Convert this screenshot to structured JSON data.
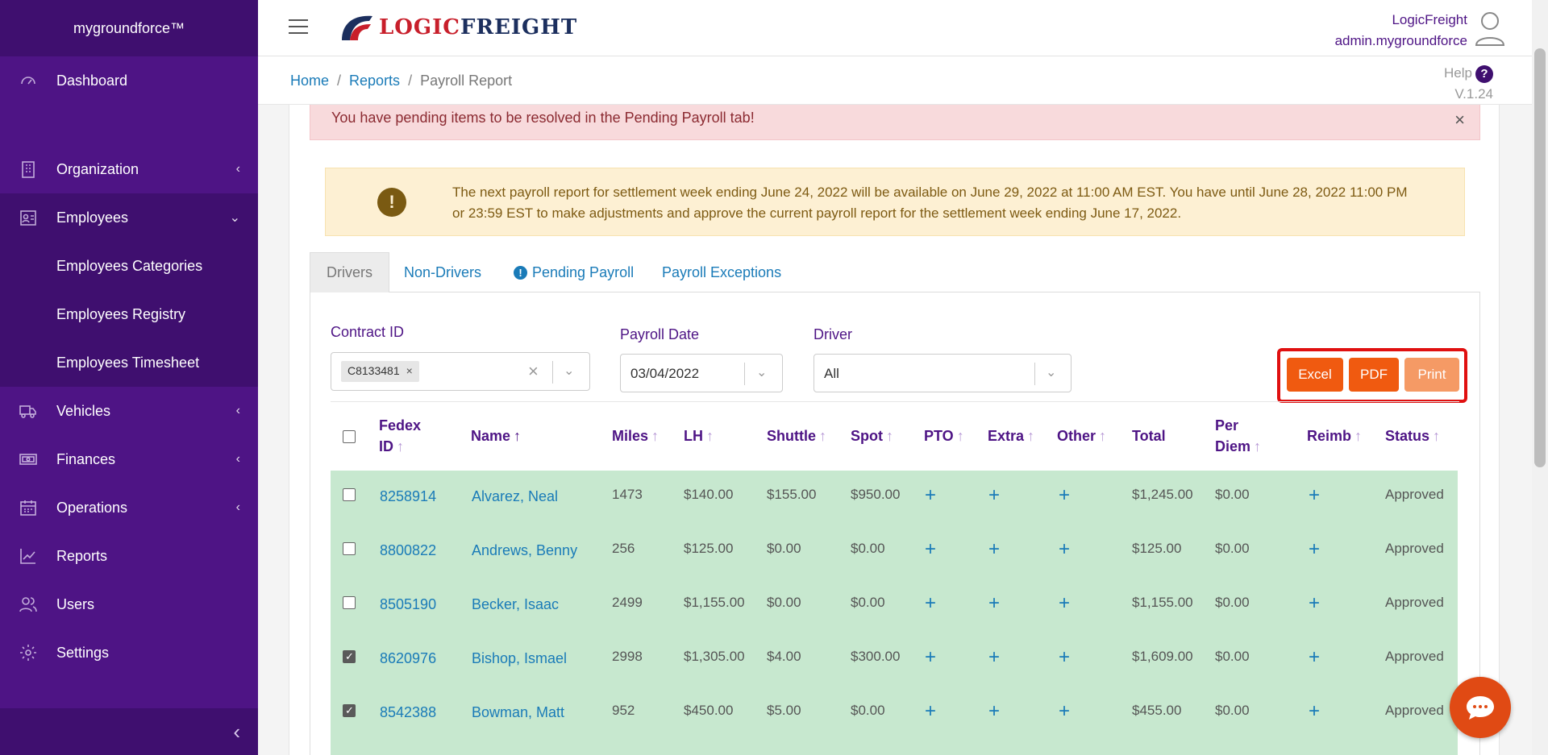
{
  "sidebar": {
    "brand": "mygroundforce™",
    "items": [
      {
        "label": "Dashboard",
        "icon": "dashboard-icon"
      },
      {
        "label": "Organization",
        "icon": "building-icon"
      },
      {
        "label": "Employees",
        "icon": "employee-badge-icon"
      },
      {
        "label": "Vehicles",
        "icon": "truck-icon"
      },
      {
        "label": "Finances",
        "icon": "money-icon"
      },
      {
        "label": "Operations",
        "icon": "calendar-icon"
      },
      {
        "label": "Reports",
        "icon": "chart-icon"
      },
      {
        "label": "Users",
        "icon": "users-icon"
      },
      {
        "label": "Settings",
        "icon": "gear-icon"
      }
    ],
    "subitems": [
      "Employees Categories",
      "Employees Registry",
      "Employees Timesheet"
    ]
  },
  "header": {
    "logo_part1": "LOGIC",
    "logo_part2": "FREIGHT",
    "user_company": "LogicFreight",
    "user_name": "admin.mygroundforce"
  },
  "breadcrumb": {
    "home": "Home",
    "reports": "Reports",
    "current": "Payroll Report",
    "sep": "/"
  },
  "help": {
    "label": "Help",
    "version": "V.1.24"
  },
  "alerts": {
    "pending": "You have pending items to be resolved in the Pending Payroll tab!",
    "info_line1": "The next payroll report for settlement week ending June 24, 2022 will be available on June 29, 2022 at 11:00 AM EST. You have until June 28, 2022 11:00 PM",
    "info_line2": "or 23:59 EST to make adjustments and approve the current payroll report for the settlement week ending June 17, 2022."
  },
  "tabs": [
    "Drivers",
    "Non-Drivers",
    "Pending Payroll",
    "Payroll Exceptions"
  ],
  "filters": {
    "contract_label": "Contract ID",
    "contract_chip": "C8133481",
    "payroll_date_label": "Payroll Date",
    "payroll_date": "03/04/2022",
    "driver_label": "Driver",
    "driver_value": "All"
  },
  "buttons": {
    "excel": "Excel",
    "pdf": "PDF",
    "print": "Print"
  },
  "columns": {
    "fedex1": "Fedex",
    "fedex2": "ID",
    "name": "Name",
    "miles": "Miles",
    "lh": "LH",
    "shuttle": "Shuttle",
    "spot": "Spot",
    "pto": "PTO",
    "extra": "Extra",
    "other": "Other",
    "total": "Total",
    "perdiem1": "Per",
    "perdiem2": "Diem",
    "reimb": "Reimb",
    "status": "Status"
  },
  "rows": [
    {
      "id": "8258914",
      "name": "Alvarez, Neal",
      "miles": "1473",
      "lh": "$140.00",
      "shuttle": "$155.00",
      "spot": "$950.00",
      "total": "$1,245.00",
      "perdiem": "$0.00",
      "status": "Approved",
      "checked": false
    },
    {
      "id": "8800822",
      "name": "Andrews, Benny",
      "miles": "256",
      "lh": "$125.00",
      "shuttle": "$0.00",
      "spot": "$0.00",
      "total": "$125.00",
      "perdiem": "$0.00",
      "status": "Approved",
      "checked": false
    },
    {
      "id": "8505190",
      "name": "Becker, Isaac",
      "miles": "2499",
      "lh": "$1,155.00",
      "shuttle": "$0.00",
      "spot": "$0.00",
      "total": "$1,155.00",
      "perdiem": "$0.00",
      "status": "Approved",
      "checked": false
    },
    {
      "id": "8620976",
      "name": "Bishop, Ismael",
      "miles": "2998",
      "lh": "$1,305.00",
      "shuttle": "$4.00",
      "spot": "$300.00",
      "total": "$1,609.00",
      "perdiem": "$0.00",
      "status": "Approved",
      "checked": true
    },
    {
      "id": "8542388",
      "name": "Bowman, Matt",
      "miles": "952",
      "lh": "$450.00",
      "shuttle": "$5.00",
      "spot": "$0.00",
      "total": "$455.00",
      "perdiem": "$0.00",
      "status": "Approved",
      "checked": true
    }
  ],
  "plus_symbol": "+",
  "colors": {
    "sidebar": "#4e1485",
    "accent_orange": "#f05a10",
    "row_green": "#c7e8cf",
    "link": "#1a7bb8"
  }
}
